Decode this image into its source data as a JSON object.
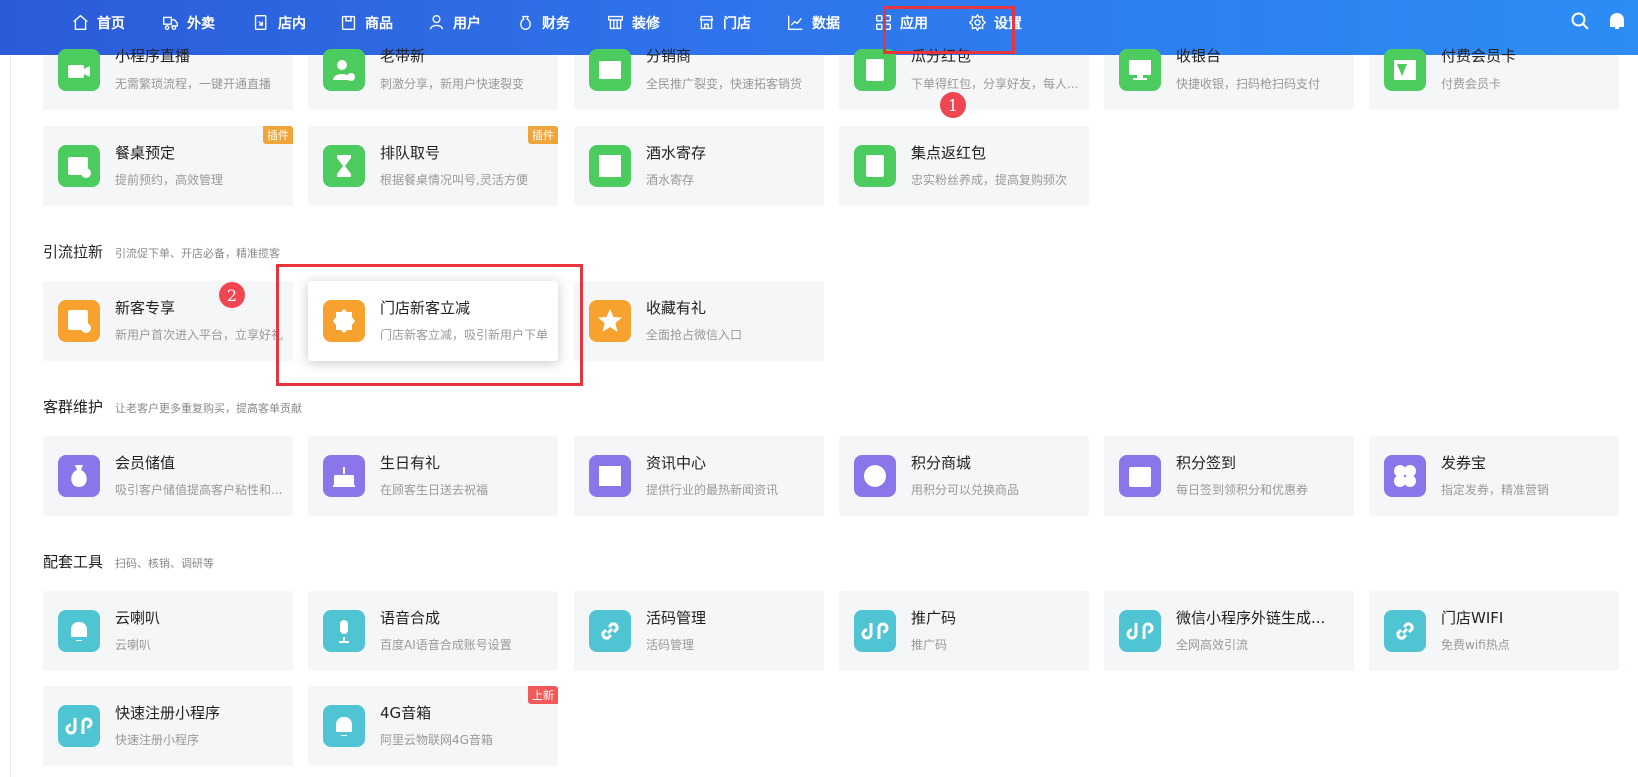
{
  "nav": {
    "items": [
      {
        "label": "首页",
        "icon": "home-icon"
      },
      {
        "label": "外卖",
        "icon": "delivery-icon"
      },
      {
        "label": "店内",
        "icon": "dine-in-icon"
      },
      {
        "label": "商品",
        "icon": "product-icon"
      },
      {
        "label": "用户",
        "icon": "user-icon"
      },
      {
        "label": "财务",
        "icon": "finance-icon"
      },
      {
        "label": "装修",
        "icon": "decoration-icon"
      },
      {
        "label": "门店",
        "icon": "store-icon"
      },
      {
        "label": "数据",
        "icon": "data-chart-icon"
      },
      {
        "label": "应用",
        "icon": "apps-grid-icon"
      },
      {
        "label": "设置",
        "icon": "settings-gear-icon"
      }
    ],
    "right_icons": [
      "search-icon",
      "bell-icon"
    ]
  },
  "top_row": [
    {
      "name": "小程序直播",
      "desc": "无需繁琐流程，一键开通直播",
      "icon": "video-camera-icon",
      "color": "#4ccb5e"
    },
    {
      "name": "老带新",
      "desc": "刺激分享，新用户快速裂变",
      "icon": "add-user-icon",
      "color": "#4ccb5e"
    },
    {
      "name": "分销商",
      "desc": "全民推广裂变，快速拓客销货",
      "icon": "image-icon",
      "color": "#4ccb5e"
    },
    {
      "name": "瓜分红包",
      "desc": "下单得红包，分享好友，每人...",
      "icon": "red-envelope-icon",
      "color": "#4ccb5e"
    },
    {
      "name": "收银台",
      "desc": "快捷收银，扫码枪扫码支付",
      "icon": "cashier-monitor-icon",
      "color": "#4ccb5e"
    },
    {
      "name": "付费会员卡",
      "desc": "付费会员卡",
      "icon": "vip-card-icon",
      "color": "#4ccb5e"
    }
  ],
  "second_row": [
    {
      "name": "餐桌预定",
      "desc": "提前预约，高效管理",
      "icon": "calendar-clock-icon",
      "tag": "插件"
    },
    {
      "name": "排队取号",
      "desc": "根据餐桌情况叫号,灵活方便",
      "icon": "hourglass-icon",
      "tag": "插件"
    },
    {
      "name": "酒水寄存",
      "desc": "酒水寄存",
      "icon": "storage-box-icon",
      "tag": ""
    },
    {
      "name": "集点返红包",
      "desc": "忠实粉丝养成，提高复购频次",
      "icon": "red-envelope-icon",
      "tag": ""
    }
  ],
  "sections": {
    "traffic": {
      "title": "引流拉新",
      "desc": "引流促下单、开店必备，精准揽客"
    },
    "retention": {
      "title": "客群维护",
      "desc": "让老客户更多重复购买，提高客单贡献"
    },
    "tools": {
      "title": "配套工具",
      "desc": "扫码、核销、调研等"
    }
  },
  "traffic_row": [
    {
      "name": "新客专享",
      "desc": "新用户首次进入平台，立享好礼",
      "icon": "new-customer-icon"
    },
    {
      "name": "门店新客立减",
      "desc": "门店新客立减，吸引新用户下单",
      "icon": "discount-badge-icon"
    },
    {
      "name": "收藏有礼",
      "desc": "全面抢占微信入口",
      "icon": "star-icon"
    }
  ],
  "retention_row": [
    {
      "name": "会员储值",
      "desc": "吸引客户储值提高客户粘性和...",
      "icon": "money-bag-icon"
    },
    {
      "name": "生日有礼",
      "desc": "在顾客生日送去祝福",
      "icon": "birthday-cake-icon"
    },
    {
      "name": "资讯中心",
      "desc": "提供行业的最热新闻资讯",
      "icon": "news-icon"
    },
    {
      "name": "积分商城",
      "desc": "用积分可以兑换商品",
      "icon": "points-diamond-icon"
    },
    {
      "name": "积分签到",
      "desc": "每日签到领积分和优惠券",
      "icon": "calendar-check-icon"
    },
    {
      "name": "发券宝",
      "desc": "指定发券，精准营销",
      "icon": "clover-icon"
    }
  ],
  "tools_row": [
    {
      "name": "云喇叭",
      "desc": "云喇叭",
      "icon": "bell-icon",
      "tag": ""
    },
    {
      "name": "语音合成",
      "desc": "百度AI语音合成账号设置",
      "icon": "microphone-icon",
      "tag": ""
    },
    {
      "name": "活码管理",
      "desc": "活码管理",
      "icon": "link-icon",
      "tag": ""
    },
    {
      "name": "推广码",
      "desc": "推广码",
      "icon": "miniprogram-icon",
      "tag": ""
    },
    {
      "name": "微信小程序外链生成...",
      "desc": "全网高效引流",
      "icon": "miniprogram-icon",
      "tag": ""
    },
    {
      "name": "门店WIFI",
      "desc": "免费wifi热点",
      "icon": "link-icon",
      "tag": ""
    },
    {
      "name": "快速注册小程序",
      "desc": "快速注册小程序",
      "icon": "miniprogram-icon",
      "tag": ""
    },
    {
      "name": "4G音箱",
      "desc": "阿里云物联网4G音箱",
      "icon": "bell-icon",
      "tag": "上新"
    }
  ],
  "annotations": {
    "step1": "1",
    "step2": "2"
  },
  "colors": {
    "green": "#4ccb5e",
    "orange": "#f7a12e",
    "purple": "#8a75ea",
    "teal": "#4fc5d3",
    "tag_plugin": "#f0a53a",
    "tag_new": "#f05a5a",
    "highlight": "#e7343f"
  }
}
